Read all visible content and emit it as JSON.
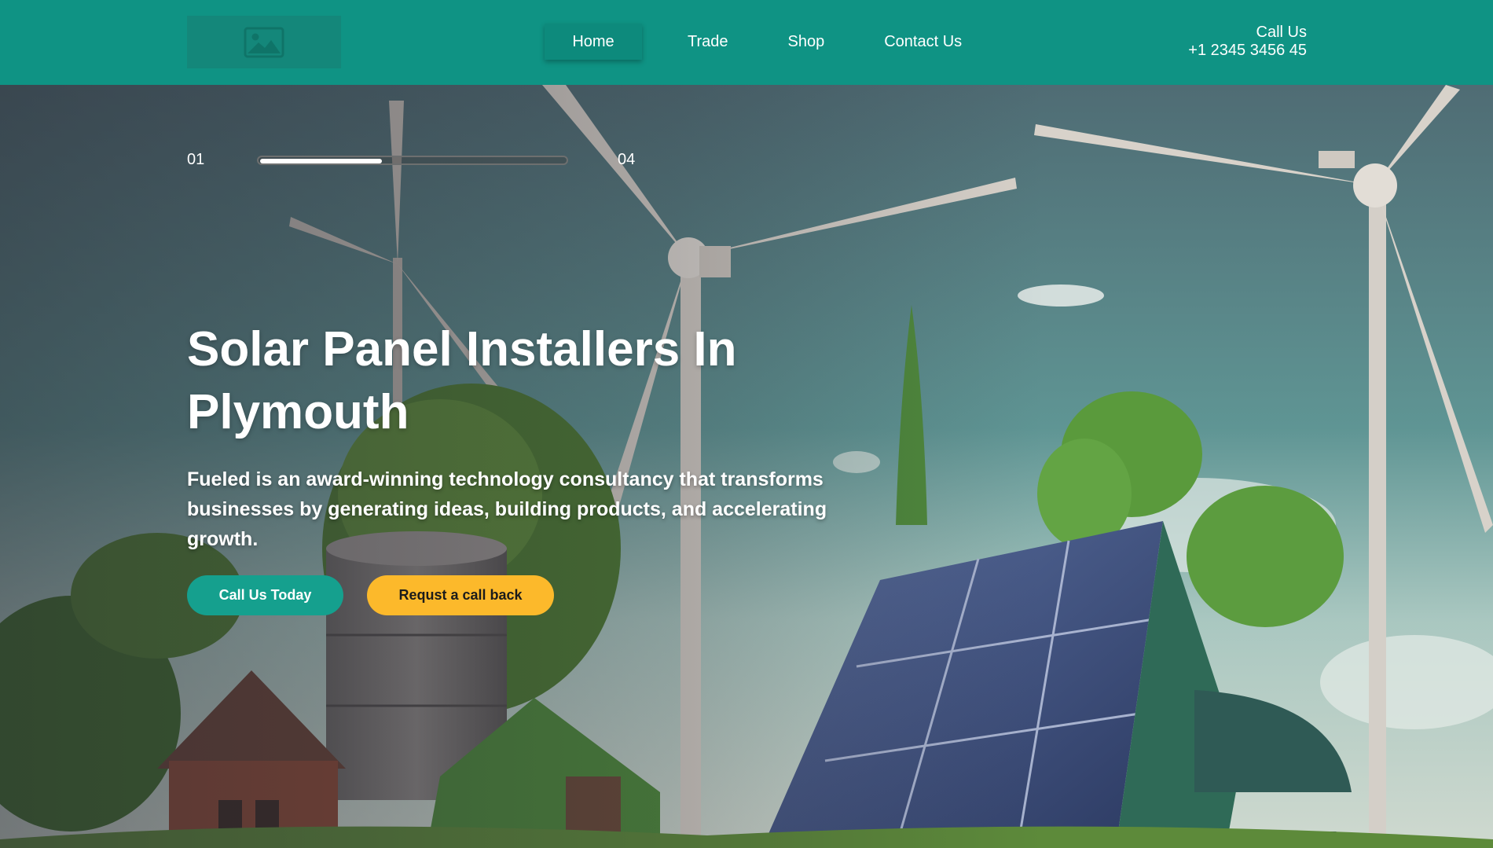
{
  "header": {
    "logo_icon": "image-placeholder-icon",
    "nav": [
      {
        "label": "Home",
        "active": true
      },
      {
        "label": "Trade",
        "active": false
      },
      {
        "label": "Shop",
        "active": false
      },
      {
        "label": "Contact Us",
        "active": false
      }
    ],
    "call_label": "Call Us",
    "call_number": "+1 2345 3456 45"
  },
  "hero": {
    "slide_current": "01",
    "slide_total": "04",
    "progress": 0.4,
    "title": "Solar Panel Installers In Plymouth",
    "description": "Fueled is an award-winning technology consultancy that transforms businesses by generating ideas, building products, and accelerating growth.",
    "primary_button": "Call Us Today",
    "secondary_button": "Requst a call back"
  },
  "colors": {
    "header_bg": "#0f9384",
    "primary_button": "#15a08e",
    "secondary_button": "#fcb92b"
  }
}
